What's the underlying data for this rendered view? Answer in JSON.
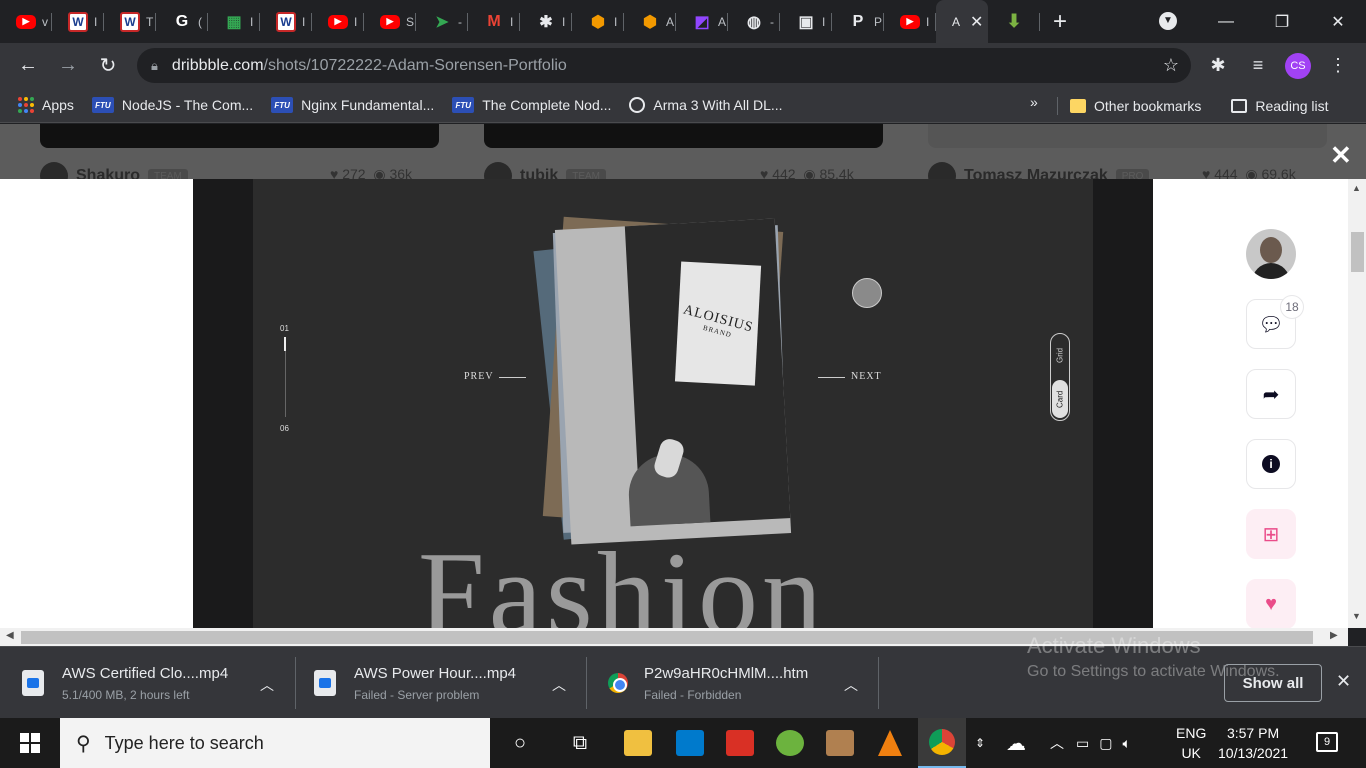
{
  "browser": {
    "tabs": [
      {
        "icon": "youtube-icon",
        "label": "v",
        "color": "#ff0000"
      },
      {
        "icon": "w-icon",
        "label": "I",
        "color": "#ffffff"
      },
      {
        "icon": "w-icon",
        "label": "T",
        "color": "#ffffff"
      },
      {
        "icon": "google-icon",
        "label": "(",
        "color": "#ffffff"
      },
      {
        "icon": "sheets-icon",
        "label": "I",
        "color": "#34a853"
      },
      {
        "icon": "w-icon",
        "label": "I",
        "color": "#ffffff"
      },
      {
        "icon": "youtube-icon",
        "label": "I",
        "color": "#ff0000"
      },
      {
        "icon": "youtube-icon",
        "label": "S",
        "color": "#ff0000"
      },
      {
        "icon": "send-icon",
        "label": "-",
        "color": "#34a853"
      },
      {
        "icon": "gmail-icon",
        "label": "I",
        "color": "#ea4335"
      },
      {
        "icon": "extension-icon",
        "label": "I",
        "color": "#e8eaed"
      },
      {
        "icon": "box-icon",
        "label": "I",
        "color": "#f29900"
      },
      {
        "icon": "box-icon",
        "label": "A",
        "color": "#f29900"
      },
      {
        "icon": "twitch-icon",
        "label": "A",
        "color": "#9146ff"
      },
      {
        "icon": "globe-icon",
        "label": "-",
        "color": "#e8eaed"
      },
      {
        "icon": "terminal-icon",
        "label": "I",
        "color": "#e8eaed"
      },
      {
        "icon": "p-icon",
        "label": "P",
        "color": "#e8eaed"
      },
      {
        "icon": "youtube-icon",
        "label": "I",
        "color": "#ff0000"
      }
    ],
    "active_tab_label": "A",
    "url_host": "dribbble.com",
    "url_path": "/shots/10722222-Adam-Sorensen-Portfolio",
    "profile_initials": "CS"
  },
  "bookmarks": {
    "apps_label": "Apps",
    "items": [
      {
        "label": "NodeJS - The Com...",
        "icon": "ftu"
      },
      {
        "label": "Nginx Fundamental...",
        "icon": "ftu"
      },
      {
        "label": "The Complete Nod...",
        "icon": "ftu"
      },
      {
        "label": "Arma 3 With All DL...",
        "icon": "globe"
      }
    ],
    "more": "»",
    "other": "Other bookmarks",
    "reading": "Reading list"
  },
  "background_feed": [
    {
      "user": "Shakuro",
      "badge": "TEAM",
      "likes": "272",
      "views": "36k"
    },
    {
      "user": "tubik",
      "badge": "TEAM",
      "likes": "442",
      "views": "85.4k"
    },
    {
      "user": "Tomasz Mazurczak",
      "badge": "PRO",
      "likes": "444",
      "views": "69.6k"
    }
  ],
  "shot": {
    "counter_start": "01",
    "counter_end": "06",
    "prev": "PREV",
    "next": "NEXT",
    "brand_line1": "ALOISIUS",
    "brand_line2": "BRAND",
    "view_grid": "Grid",
    "view_card": "Card",
    "headline": "Fashion"
  },
  "actions": {
    "comment_count": "18"
  },
  "downloads": [
    {
      "name": "AWS Certified Clo....mp4",
      "status": "5.1/400 MB, 2 hours left"
    },
    {
      "name": "AWS Power Hour....mp4",
      "status": "Failed - Server problem"
    },
    {
      "name": "P2w9aHR0cHMlM....htm",
      "status": "Failed - Forbidden"
    }
  ],
  "downloads_show_all": "Show all",
  "watermark": {
    "line1": "Activate Windows",
    "line2": "Go to Settings to activate Windows."
  },
  "taskbar": {
    "search_placeholder": "Type here to search",
    "lang1": "ENG",
    "lang2": "UK",
    "time": "3:57 PM",
    "date": "10/13/2021",
    "notifications": "9"
  }
}
